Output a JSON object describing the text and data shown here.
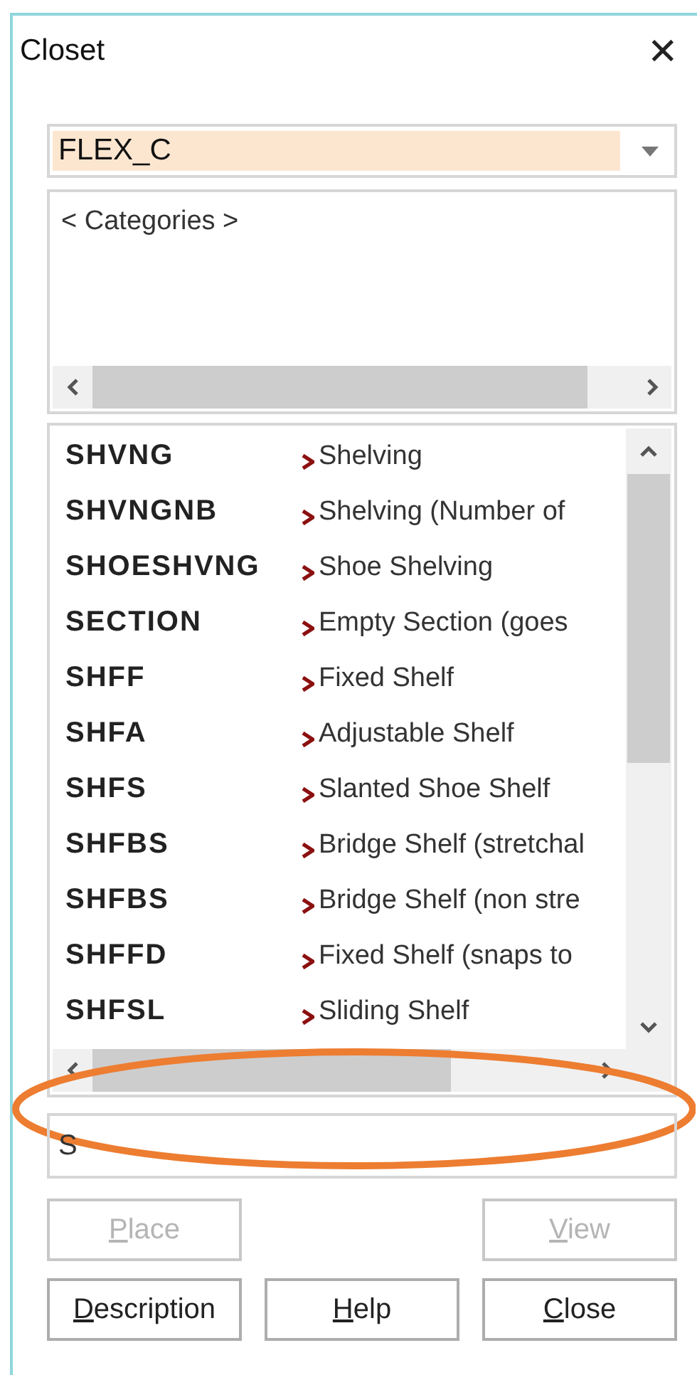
{
  "window": {
    "title": "Closet",
    "close_glyph": "✕"
  },
  "library": {
    "value": "FLEX_C"
  },
  "categories": {
    "items": [
      "< Categories >"
    ]
  },
  "items": [
    {
      "code": "SHVNG",
      "description": "Shelving"
    },
    {
      "code": "SHVNGNB",
      "description": "Shelving (Number of"
    },
    {
      "code": "SHOESHVNG",
      "description": "Shoe Shelving"
    },
    {
      "code": "SECTION",
      "description": "Empty Section (goes"
    },
    {
      "code": "SHFF",
      "description": "Fixed Shelf"
    },
    {
      "code": "SHFA",
      "description": "Adjustable Shelf"
    },
    {
      "code": "SHFS",
      "description": "Slanted Shoe Shelf"
    },
    {
      "code": "SHFBS",
      "description": "Bridge Shelf (stretchal"
    },
    {
      "code": "SHFBS",
      "description": "Bridge Shelf (non stre"
    },
    {
      "code": "SHFFD",
      "description": "Fixed Shelf (snaps to"
    },
    {
      "code": "SHFSL",
      "description": "Sliding Shelf"
    }
  ],
  "filter": {
    "value": "S"
  },
  "buttons": [
    {
      "label": "Place",
      "disabled": true
    },
    {
      "label": "View",
      "disabled": true
    },
    {
      "label": "Description",
      "disabled": false
    },
    {
      "label": "Help",
      "disabled": false
    },
    {
      "label": "Close",
      "disabled": false
    }
  ]
}
